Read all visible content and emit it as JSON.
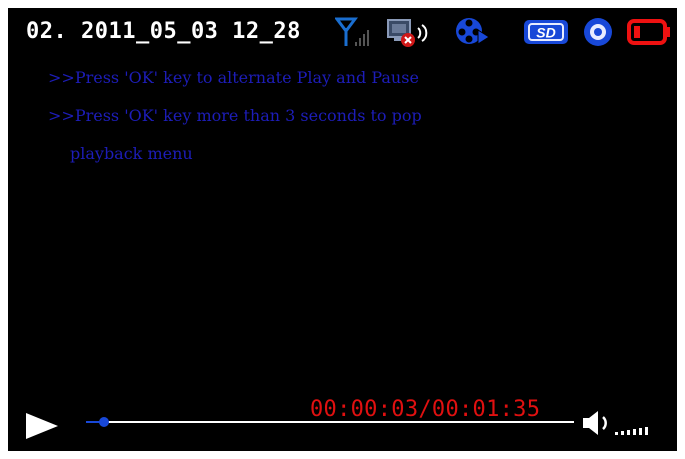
{
  "status_bar": {
    "file_name": "02. 2011_05_03 12_28",
    "storage_label": "SD"
  },
  "messages": {
    "line1": ">>Press 'OK' key to alternate Play and Pause",
    "line2": ">>Press 'OK' key more than 3 seconds to pop",
    "line3": "playback menu"
  },
  "playback": {
    "time": "00:00:03/00:01:35",
    "progress_fraction": 0.036
  },
  "colors": {
    "screen_bg": "#000000",
    "message_text": "#1d1db8",
    "time_text": "#e01010",
    "accent_blue": "#1848d8"
  },
  "icons": [
    "signal-icon",
    "video-out-disconnected-icon",
    "film-reel-play-icon",
    "sd-card-icon",
    "eye-icon",
    "battery-low-icon",
    "play-icon",
    "volume-icon"
  ]
}
